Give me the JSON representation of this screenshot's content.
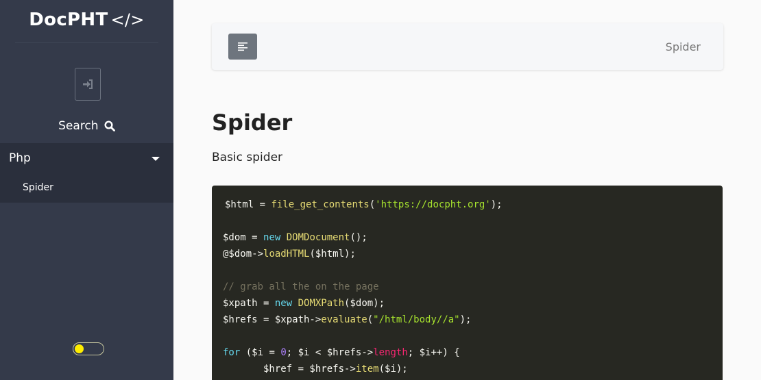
{
  "app": {
    "brand": "DocPHT",
    "brand_icon": "</>"
  },
  "sidebar": {
    "search_label": "Search",
    "menu": {
      "heading": "Php",
      "items": [
        {
          "label": "Spider"
        }
      ]
    },
    "theme_toggle": {
      "state": "light",
      "knob_color": "#ffed00"
    }
  },
  "topbar": {
    "breadcrumb": "Spider"
  },
  "page": {
    "title": "Spider",
    "description": "Basic spider"
  },
  "code": {
    "language": "php",
    "lines": [
      [
        {
          "t": "$html = ",
          "c": ""
        },
        {
          "t": "file_get_contents",
          "c": "fn"
        },
        {
          "t": "(",
          "c": ""
        },
        {
          "t": "'https://docpht.org'",
          "c": "str"
        },
        {
          "t": ");",
          "c": ""
        }
      ],
      [],
      [
        {
          "t": "$dom = ",
          "c": ""
        },
        {
          "t": "new",
          "c": "kw"
        },
        {
          "t": " ",
          "c": ""
        },
        {
          "t": "DOMDocument",
          "c": "fn"
        },
        {
          "t": "();",
          "c": ""
        }
      ],
      [
        {
          "t": "@$dom->",
          "c": ""
        },
        {
          "t": "loadHTML",
          "c": "fn"
        },
        {
          "t": "($html);",
          "c": ""
        }
      ],
      [],
      [
        {
          "t": "// grab all the on the page",
          "c": "cm"
        }
      ],
      [
        {
          "t": "$xpath = ",
          "c": ""
        },
        {
          "t": "new",
          "c": "kw"
        },
        {
          "t": " ",
          "c": ""
        },
        {
          "t": "DOMXPath",
          "c": "fn"
        },
        {
          "t": "($dom);",
          "c": ""
        }
      ],
      [
        {
          "t": "$hrefs = $xpath->",
          "c": ""
        },
        {
          "t": "evaluate",
          "c": "fn"
        },
        {
          "t": "(",
          "c": ""
        },
        {
          "t": "\"/html/body//a\"",
          "c": "str"
        },
        {
          "t": ");",
          "c": ""
        }
      ],
      [],
      [
        {
          "t": "for",
          "c": "kw"
        },
        {
          "t": " ($i = ",
          "c": ""
        },
        {
          "t": "0",
          "c": "num"
        },
        {
          "t": "; $i < $hrefs->",
          "c": ""
        },
        {
          "t": "length",
          "c": "prop"
        },
        {
          "t": "; $i++) {",
          "c": ""
        }
      ],
      [
        {
          "t": "       $href = $hrefs->",
          "c": ""
        },
        {
          "t": "item",
          "c": "fn"
        },
        {
          "t": "($i);",
          "c": ""
        }
      ]
    ]
  }
}
